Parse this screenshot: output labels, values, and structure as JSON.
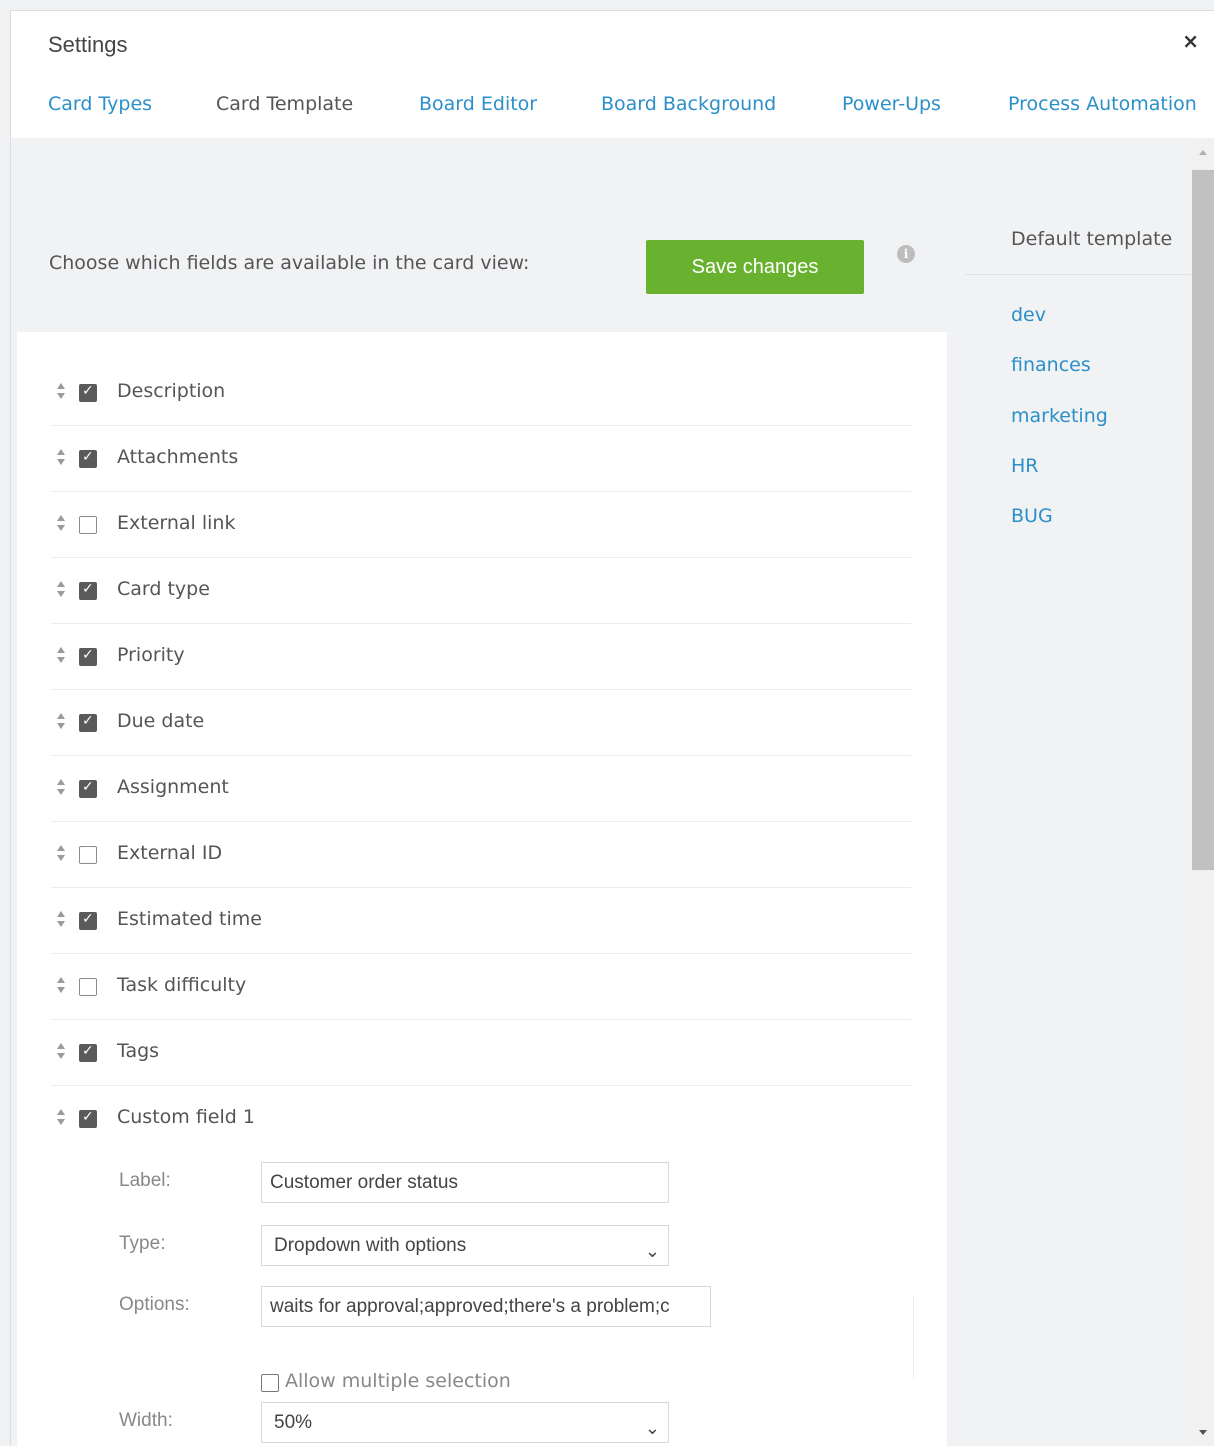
{
  "dialog": {
    "title": "Settings",
    "close_label": "×"
  },
  "tabs": [
    {
      "label": "Card Types",
      "active": false
    },
    {
      "label": "Card Template",
      "active": true
    },
    {
      "label": "Board Editor",
      "active": false
    },
    {
      "label": "Board Background",
      "active": false
    },
    {
      "label": "Power-Ups",
      "active": false
    },
    {
      "label": "Process Automation",
      "active": false
    }
  ],
  "panel": {
    "header_text": "Choose which fields are available in the card view:",
    "save_label": "Save changes",
    "info_glyph": "i"
  },
  "fields": [
    {
      "label": "Description",
      "checked": true
    },
    {
      "label": "Attachments",
      "checked": true
    },
    {
      "label": "External link",
      "checked": false
    },
    {
      "label": "Card type",
      "checked": true
    },
    {
      "label": "Priority",
      "checked": true
    },
    {
      "label": "Due date",
      "checked": true
    },
    {
      "label": "Assignment",
      "checked": true
    },
    {
      "label": "External ID",
      "checked": false
    },
    {
      "label": "Estimated time",
      "checked": true
    },
    {
      "label": "Task difficulty",
      "checked": false
    },
    {
      "label": "Tags",
      "checked": true
    },
    {
      "label": "Custom field 1",
      "checked": true
    }
  ],
  "custom_field": {
    "label_label": "Label:",
    "label_value": "Customer order status",
    "type_label": "Type:",
    "type_value": "Dropdown with options",
    "options_label": "Options:",
    "options_value": "waits for approval;approved;there's a problem;c",
    "allow_multiple_label": "Allow multiple selection",
    "allow_multiple_checked": false,
    "width_label": "Width:",
    "width_value": "50%"
  },
  "sidebar": {
    "title": "Default template",
    "templates": [
      "dev",
      "finances",
      "marketing",
      "HR",
      "BUG"
    ]
  },
  "colors": {
    "link": "#2b8fc9",
    "save_button": "#69b22f"
  }
}
